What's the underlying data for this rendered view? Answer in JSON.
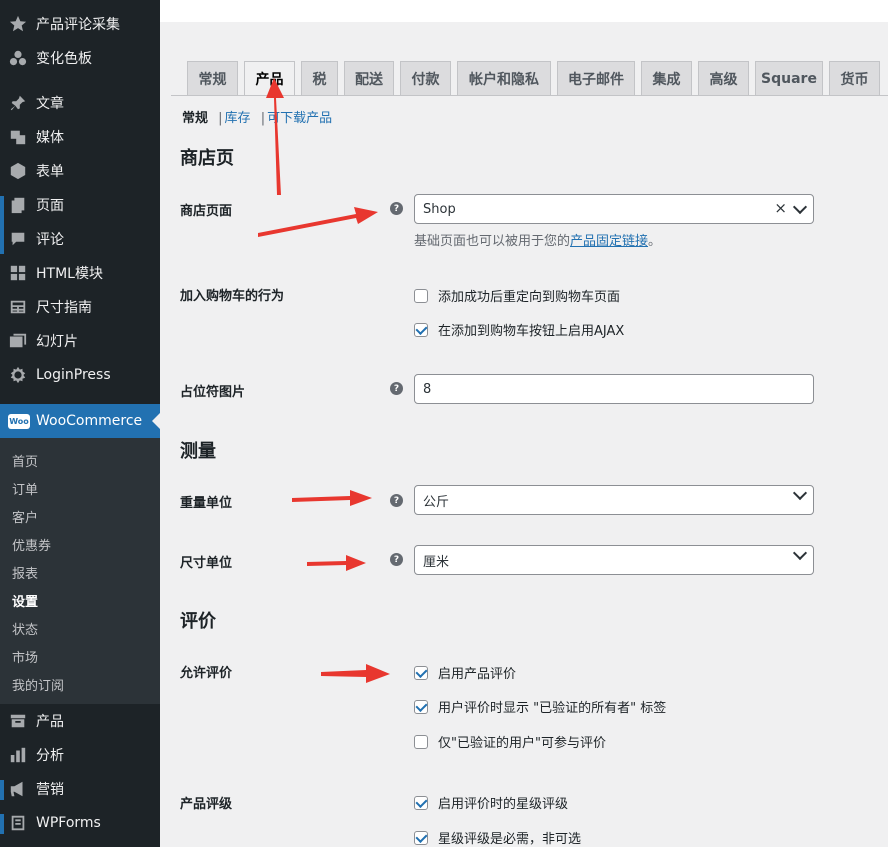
{
  "sidebar": {
    "items": [
      {
        "label": "产品评论采集",
        "icon": "star-icon"
      },
      {
        "label": "变化色板",
        "icon": "palette-icon"
      },
      {
        "label": "文章",
        "icon": "pin-icon"
      },
      {
        "label": "媒体",
        "icon": "media-icon"
      },
      {
        "label": "表单",
        "icon": "form-icon"
      },
      {
        "label": "页面",
        "icon": "page-icon"
      },
      {
        "label": "评论",
        "icon": "comment-icon"
      },
      {
        "label": "HTML模块",
        "icon": "grid-icon"
      },
      {
        "label": "尺寸指南",
        "icon": "table-icon"
      },
      {
        "label": "幻灯片",
        "icon": "slides-icon"
      },
      {
        "label": "LoginPress",
        "icon": "gear-icon"
      }
    ],
    "woo": {
      "label": "WooCommerce",
      "logo": "Woo"
    },
    "woo_sub": [
      "首页",
      "订单",
      "客户",
      "优惠券",
      "报表",
      "设置",
      "状态",
      "市场",
      "我的订阅"
    ],
    "woo_current": "设置",
    "bottom": [
      {
        "label": "产品",
        "icon": "archive-icon"
      },
      {
        "label": "分析",
        "icon": "chart-icon"
      },
      {
        "label": "营销",
        "icon": "megaphone-icon"
      },
      {
        "label": "WPForms",
        "icon": "wpforms-icon"
      }
    ]
  },
  "tabs": [
    "常规",
    "产品",
    "税",
    "配送",
    "付款",
    "帐户和隐私",
    "电子邮件",
    "集成",
    "高级",
    "Square",
    "货币"
  ],
  "active_tab": "产品",
  "subsub": {
    "current": "常规",
    "links": [
      "库存",
      "可下载产品"
    ],
    "sep": "|"
  },
  "sections": {
    "shop": {
      "heading": "商店页",
      "shop_page_label": "商店页面",
      "shop_page_value": "Shop",
      "shop_page_clear": "×",
      "desc_prefix": "基础页面也可以被用于您的",
      "desc_link": "产品固定链接",
      "desc_suffix": "。",
      "cart_label": "加入购物车的行为",
      "cart_opt1": "添加成功后重定向到购物车页面",
      "cart_opt2": "在添加到购物车按钮上启用AJAX",
      "placeholder_label": "占位符图片",
      "placeholder_value": "8"
    },
    "measure": {
      "heading": "测量",
      "weight_label": "重量单位",
      "weight_value": "公斤",
      "dim_label": "尺寸单位",
      "dim_value": "厘米"
    },
    "reviews": {
      "heading": "评价",
      "allow_label": "允许评价",
      "allow_opt1": "启用产品评价",
      "allow_opt2": "用户评价时显示 \"已验证的所有者\" 标签",
      "allow_opt3": "仅\"已验证的用户\"可参与评价",
      "rating_label": "产品评级",
      "rating_opt1": "启用评价时的星级评级",
      "rating_opt2": "星级评级是必需，非可选"
    }
  },
  "help_glyph": "?",
  "checkbox_states": {
    "cart_opt1": false,
    "cart_opt2": true,
    "allow_opt1": true,
    "allow_opt2": true,
    "allow_opt3": false,
    "rating_opt1": true,
    "rating_opt2": true
  },
  "colors": {
    "sidebar": "#1d2327",
    "accent": "#2271b1",
    "annotation_arrow": "#e8372f"
  }
}
